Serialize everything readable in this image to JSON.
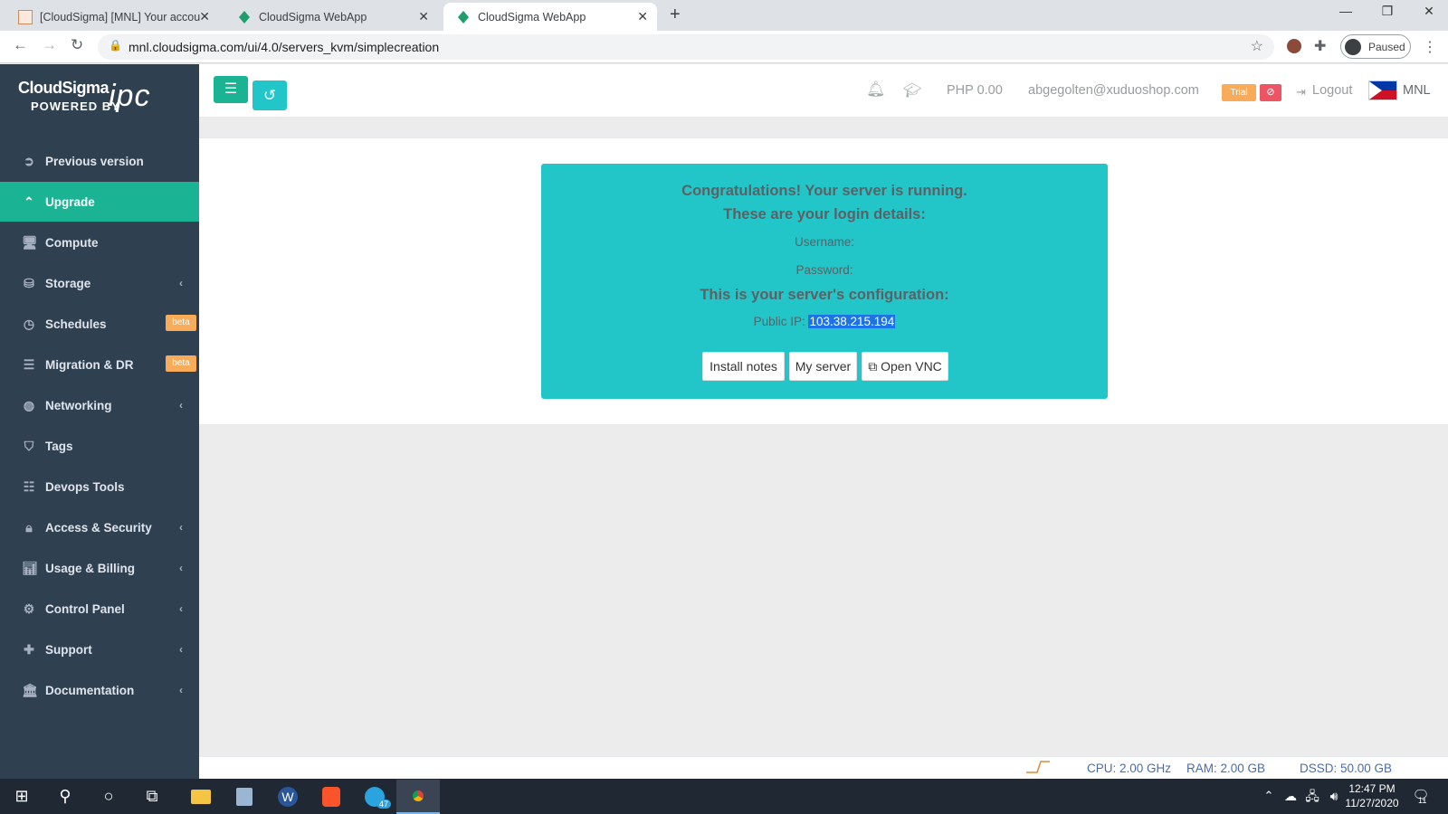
{
  "browser": {
    "tabs": [
      {
        "title": "[CloudSigma] [MNL] Your accoun",
        "active": false
      },
      {
        "title": "CloudSigma WebApp",
        "active": false
      },
      {
        "title": "CloudSigma WebApp",
        "active": true
      }
    ],
    "url": "mnl.cloudsigma.com/ui/4.0/servers_kvm/simplecreation",
    "profile_status": "Paused"
  },
  "logo": {
    "brand": "CloudSigma",
    "powered_by": "POWERED BY",
    "partner": "ipc"
  },
  "sidebar": {
    "items": [
      {
        "label": "Previous version",
        "icon": "arrow-circle-left-icon"
      },
      {
        "label": "Upgrade",
        "icon": "chevron-up-icon",
        "active": true
      },
      {
        "label": "Compute",
        "icon": "desktop-icon"
      },
      {
        "label": "Storage",
        "icon": "hdd-icon",
        "submenu": true
      },
      {
        "label": "Schedules",
        "icon": "clock-icon",
        "badge": "beta"
      },
      {
        "label": "Migration & DR",
        "icon": "server-icon",
        "badge": "beta"
      },
      {
        "label": "Networking",
        "icon": "globe-icon",
        "submenu": true
      },
      {
        "label": "Tags",
        "icon": "tags-icon"
      },
      {
        "label": "Devops Tools",
        "icon": "list-icon"
      },
      {
        "label": "Access & Security",
        "icon": "lock-icon",
        "submenu": true
      },
      {
        "label": "Usage & Billing",
        "icon": "bar-chart-icon",
        "submenu": true
      },
      {
        "label": "Control Panel",
        "icon": "cogs-icon",
        "submenu": true
      },
      {
        "label": "Support",
        "icon": "medkit-icon",
        "submenu": true
      },
      {
        "label": "Documentation",
        "icon": "bank-icon",
        "submenu": true
      }
    ]
  },
  "topbar": {
    "balance": "PHP 0.00",
    "email": "abgegolten@xuduoshop.com",
    "trial": "Trial",
    "logout": "Logout",
    "location": "MNL"
  },
  "success": {
    "line1": "Congratulations! Your server is running.",
    "line2": "These are your login details:",
    "username_label": "Username:",
    "password_label": "Password:",
    "config_heading": "This is your server's configuration:",
    "ip_label": "Public IP:",
    "ip_value": "103.38.215.194",
    "buttons": {
      "install": "Install notes",
      "my_server": "My server",
      "vnc": "Open VNC"
    }
  },
  "footer": {
    "cpu": "CPU: 2.00 GHz",
    "ram": "RAM: 2.00 GB",
    "dssd": "DSSD: 50.00 GB"
  },
  "taskbar": {
    "time": "12:47 PM",
    "date": "11/27/2020",
    "telegram_badge": "47",
    "notif_count": "11"
  },
  "colors": {
    "sidebar": "#2f4050",
    "active": "#1ab394",
    "info": "#23c6c8",
    "warning": "#f8ac59",
    "danger": "#ed5565"
  }
}
